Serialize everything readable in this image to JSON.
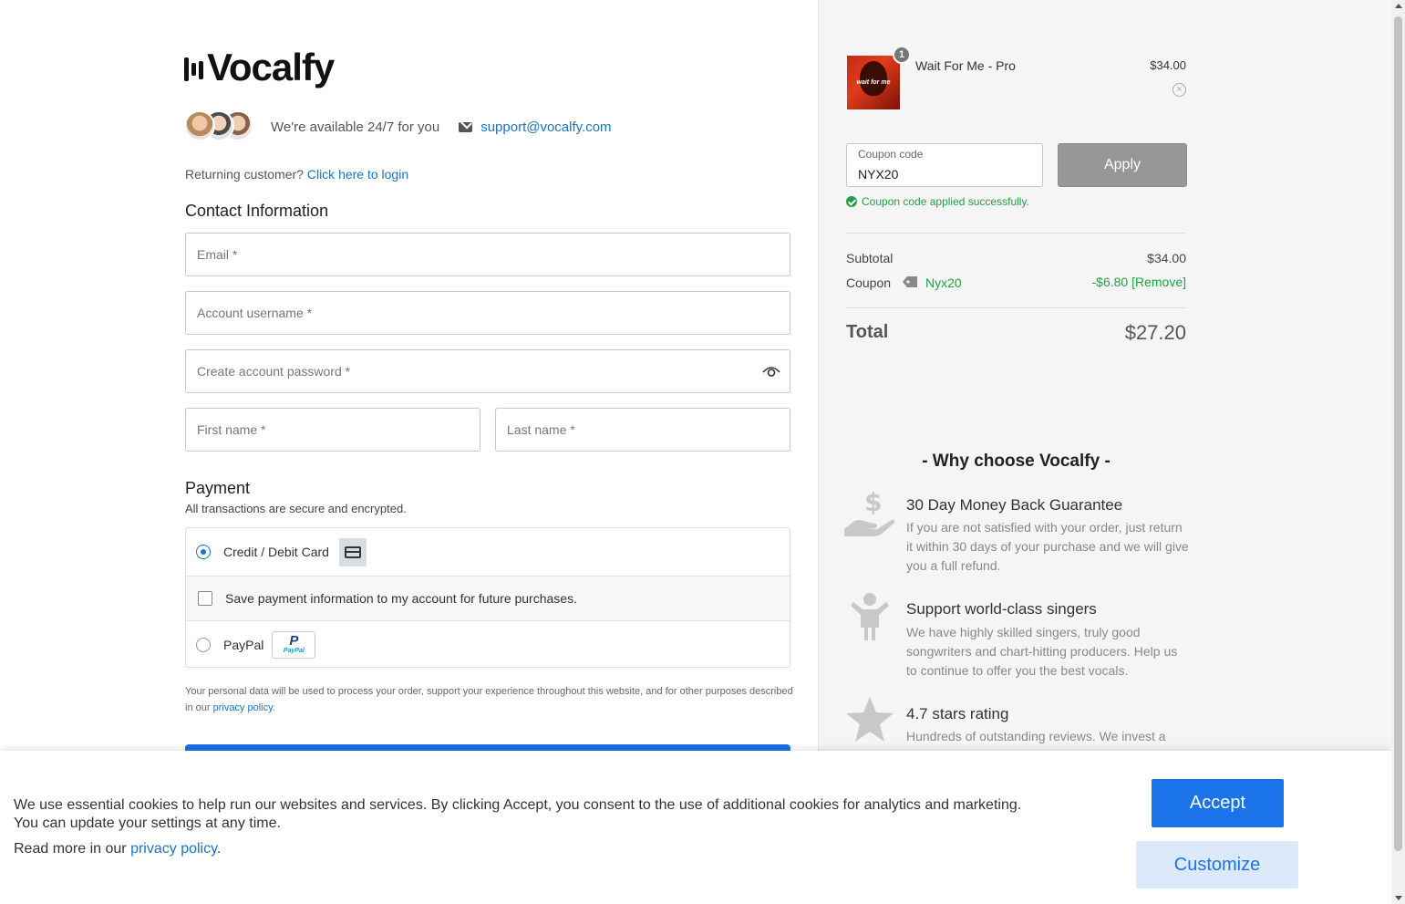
{
  "brand": {
    "name": "Vocalfy",
    "logo_icon": "sound-bars-icon"
  },
  "availability": {
    "text": "We're available 24/7 for you",
    "email": "support@vocalfy.com"
  },
  "returning": {
    "prefix": "Returning customer?",
    "link": "Click here to login"
  },
  "contact": {
    "title": "Contact Information",
    "email_placeholder": "Email *",
    "username_placeholder": "Account username *",
    "password_placeholder": "Create account password *",
    "first_name_placeholder": "First name *",
    "last_name_placeholder": "Last name *"
  },
  "payment": {
    "title": "Payment",
    "subtitle": "All transactions are secure and encrypted.",
    "card_label": "Credit / Debit Card",
    "save_label": "Save payment information to my account for future purchases.",
    "paypal_label": "PayPal",
    "paypal_logo_text": "PayPal",
    "selected": "card"
  },
  "privacy": {
    "text": "Your personal data will be used to process your order, support your experience throughout this website, and for other purposes described in our",
    "link": "privacy policy",
    "suffix": "."
  },
  "cart": {
    "item_name": "Wait For Me - Pro",
    "item_price": "$34.00",
    "item_qty": "1",
    "item_image_text": "wait for me",
    "remove_icon": "close-circle-icon"
  },
  "coupon": {
    "label": "Coupon code",
    "value": "NYX20",
    "apply_label": "Apply",
    "success": "Coupon code applied successfully."
  },
  "summary": {
    "subtotal_label": "Subtotal",
    "subtotal_value": "$34.00",
    "coupon_label": "Coupon",
    "coupon_name": "Nyx20",
    "coupon_amount": "-$6.80 [Remove]",
    "total_label": "Total",
    "total_value": "$27.20"
  },
  "why": {
    "title": "- Why choose Vocalfy -",
    "features": [
      {
        "icon": "money-hand-icon",
        "title": "30 Day Money Back Guarantee",
        "desc": "If you are not satisfied with your order, just return it within 30 days of your purchase and we will give you a full refund."
      },
      {
        "icon": "person-icon",
        "title": "Support world-class singers",
        "desc": "We have highly skilled singers, truly good songwriters and chart-hitting producers. Help us to continue to offer you the best vocals."
      },
      {
        "icon": "star-icon",
        "title": "4.7 stars rating",
        "desc": "Hundreds of outstanding reviews. We invest a"
      }
    ]
  },
  "cookie": {
    "text": "We use essential cookies to help run our websites and services. By clicking Accept, you consent to the use of additional cookies for analytics and marketing. You can update your settings at any time.",
    "read_prefix": "Read more in our",
    "read_link": "privacy policy",
    "read_suffix": ".",
    "accept_label": "Accept",
    "customize_label": "Customize"
  },
  "colors": {
    "accent": "#1a73e8",
    "link": "#1a73c8",
    "success": "#22a045",
    "sidebar_bg": "#f5f5f5"
  }
}
